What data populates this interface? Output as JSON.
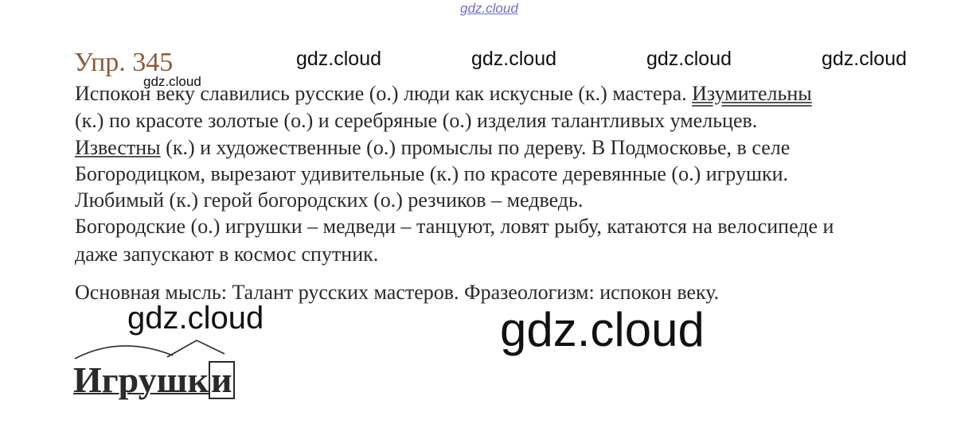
{
  "watermarks": {
    "top": "gdz.cloud",
    "row": [
      "gdz.cloud",
      "gdz.cloud",
      "gdz.cloud",
      "gdz.cloud"
    ],
    "small": "gdz.cloud",
    "mid": "gdz.cloud",
    "big": "gdz.cloud"
  },
  "exercise": {
    "title": "Упр. 345",
    "lines": [
      {
        "pre": "Испокон веку славились русские (о.) люди как искусные (к.) мастера. ",
        "mark": "Изумительны",
        "post": ""
      },
      {
        "pre": "",
        "mark": "",
        "post": "(к.) по красоте золотые (о.) и серебряные (о.) изделия талантливых умельцев."
      },
      {
        "pre": "",
        "mark": "Известны",
        "post": " (к.) и художественные (о.) промыслы по дереву. В Подмосковье, в селе"
      },
      {
        "pre": "",
        "mark": "",
        "post": "Богородицком, вырезают удивительные (к.) по красоте деревянные (о.) игрушки."
      },
      {
        "pre": "",
        "mark": "",
        "post": "Любимый (к.) герой богородских (о.) резчиков – медведь."
      },
      {
        "pre": "",
        "mark": "",
        "post": "Богородские (о.) игрушки – медведи – танцуют, ловят рыбу, катаются на велосипеде и"
      },
      {
        "pre": "",
        "mark": "",
        "post": "даже запускают в космос спутник."
      }
    ],
    "main_idea": "Основная мысль: Талант русских мастеров. Фразеологизм: испокон веку."
  },
  "morpheme": {
    "stem": "Игрушк",
    "ending": "и"
  }
}
